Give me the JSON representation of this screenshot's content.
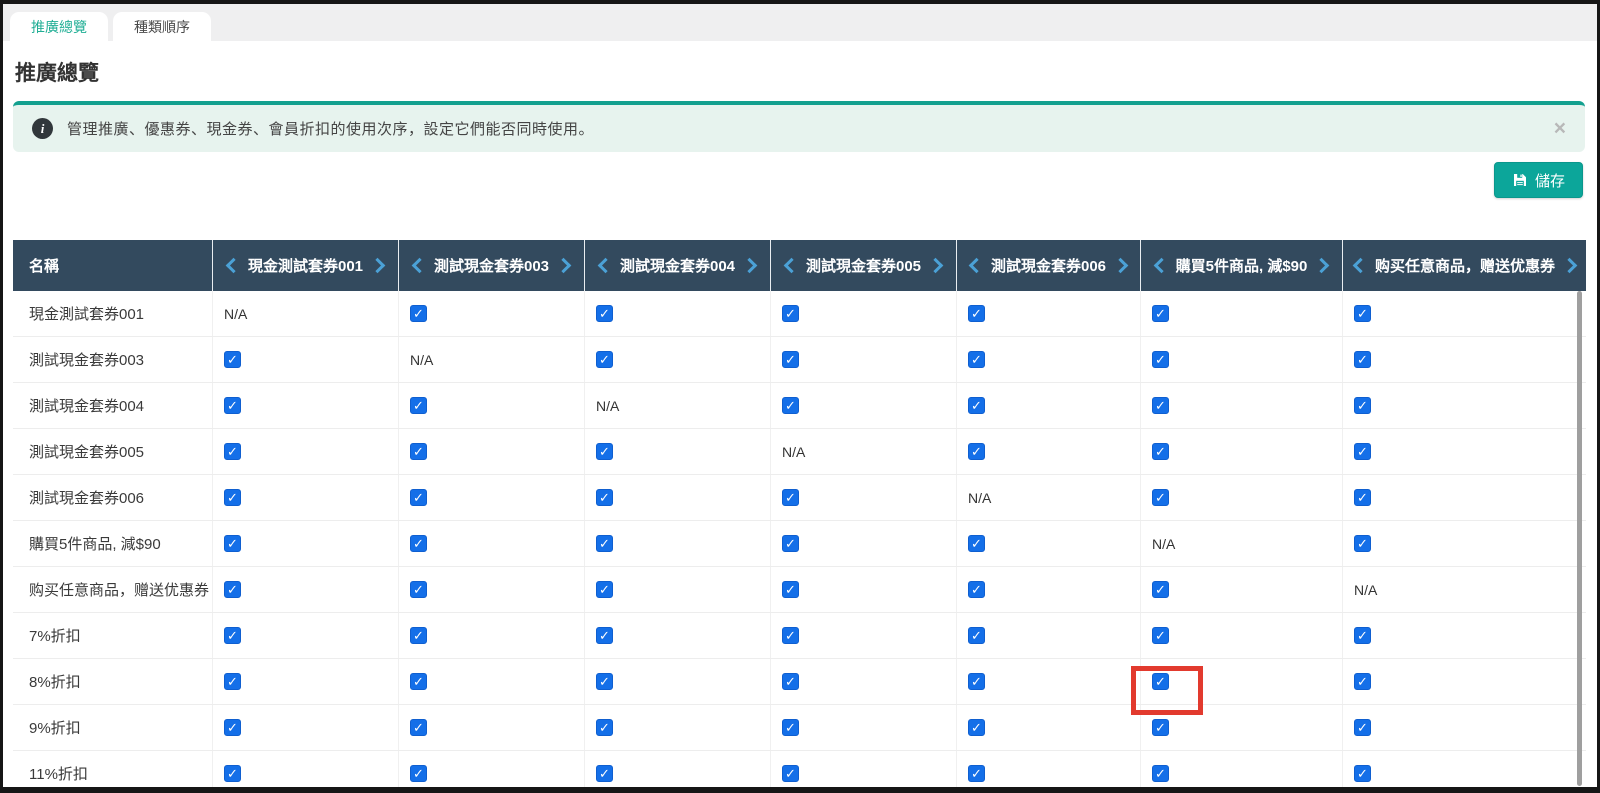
{
  "tabs": [
    {
      "label": "推廣總覽",
      "active": true
    },
    {
      "label": "種類順序",
      "active": false
    }
  ],
  "page": {
    "title": "推廣總覽"
  },
  "banner": {
    "icon": "info-icon",
    "icon_glyph": "i",
    "text": "管理推廣、優惠券、現金券、會員折扣的使用次序，設定它們能否同時使用。",
    "close_glyph": "×"
  },
  "toolbar": {
    "save_label": "儲存",
    "save_icon": "floppy-disk"
  },
  "colors": {
    "accent_teal": "#0ca69a",
    "tab_active_text": "#1fae94",
    "banner_bg": "#e7f3ee",
    "banner_top_border": "#13a08f",
    "table_header_bg": "#334a5e",
    "header_chevron_blue": "#4ba1d6",
    "checkbox_blue": "#146fe8",
    "highlight_red": "#e23a2e"
  },
  "table": {
    "name_header": "名稱",
    "na_label": "N/A",
    "check_glyph": "✓",
    "columns": [
      "現金測試套券001",
      "測試現金套券003",
      "測試現金套券004",
      "測試現金套券005",
      "測試現金套券006",
      "購買5件商品, 減$90",
      "购买任意商品，赠送优惠券"
    ],
    "rows": [
      {
        "label": "現金測試套券001",
        "cells": [
          "na",
          "checked",
          "checked",
          "checked",
          "checked",
          "checked",
          "checked"
        ]
      },
      {
        "label": "測試現金套券003",
        "cells": [
          "checked",
          "na",
          "checked",
          "checked",
          "checked",
          "checked",
          "checked"
        ]
      },
      {
        "label": "測試現金套券004",
        "cells": [
          "checked",
          "checked",
          "na",
          "checked",
          "checked",
          "checked",
          "checked"
        ]
      },
      {
        "label": "測試現金套券005",
        "cells": [
          "checked",
          "checked",
          "checked",
          "na",
          "checked",
          "checked",
          "checked"
        ]
      },
      {
        "label": "測試現金套券006",
        "cells": [
          "checked",
          "checked",
          "checked",
          "checked",
          "na",
          "checked",
          "checked"
        ]
      },
      {
        "label": "購買5件商品, 減$90",
        "cells": [
          "checked",
          "checked",
          "checked",
          "checked",
          "checked",
          "na",
          "checked"
        ]
      },
      {
        "label": "购买任意商品，赠送优惠券",
        "cells": [
          "checked",
          "checked",
          "checked",
          "checked",
          "checked",
          "checked",
          "na"
        ]
      },
      {
        "label": "7%折扣",
        "cells": [
          "checked",
          "checked",
          "checked",
          "checked",
          "checked",
          "checked",
          "checked"
        ]
      },
      {
        "label": "8%折扣",
        "cells": [
          "checked",
          "checked",
          "checked",
          "checked",
          "checked",
          "checked",
          "checked"
        ]
      },
      {
        "label": "9%折扣",
        "cells": [
          "checked",
          "checked",
          "checked",
          "checked",
          "checked",
          "checked",
          "checked"
        ]
      },
      {
        "label": "11%折扣",
        "cells": [
          "checked",
          "checked",
          "checked",
          "checked",
          "checked",
          "checked",
          "checked"
        ]
      }
    ],
    "highlight": {
      "row": 8,
      "col": 5
    }
  }
}
